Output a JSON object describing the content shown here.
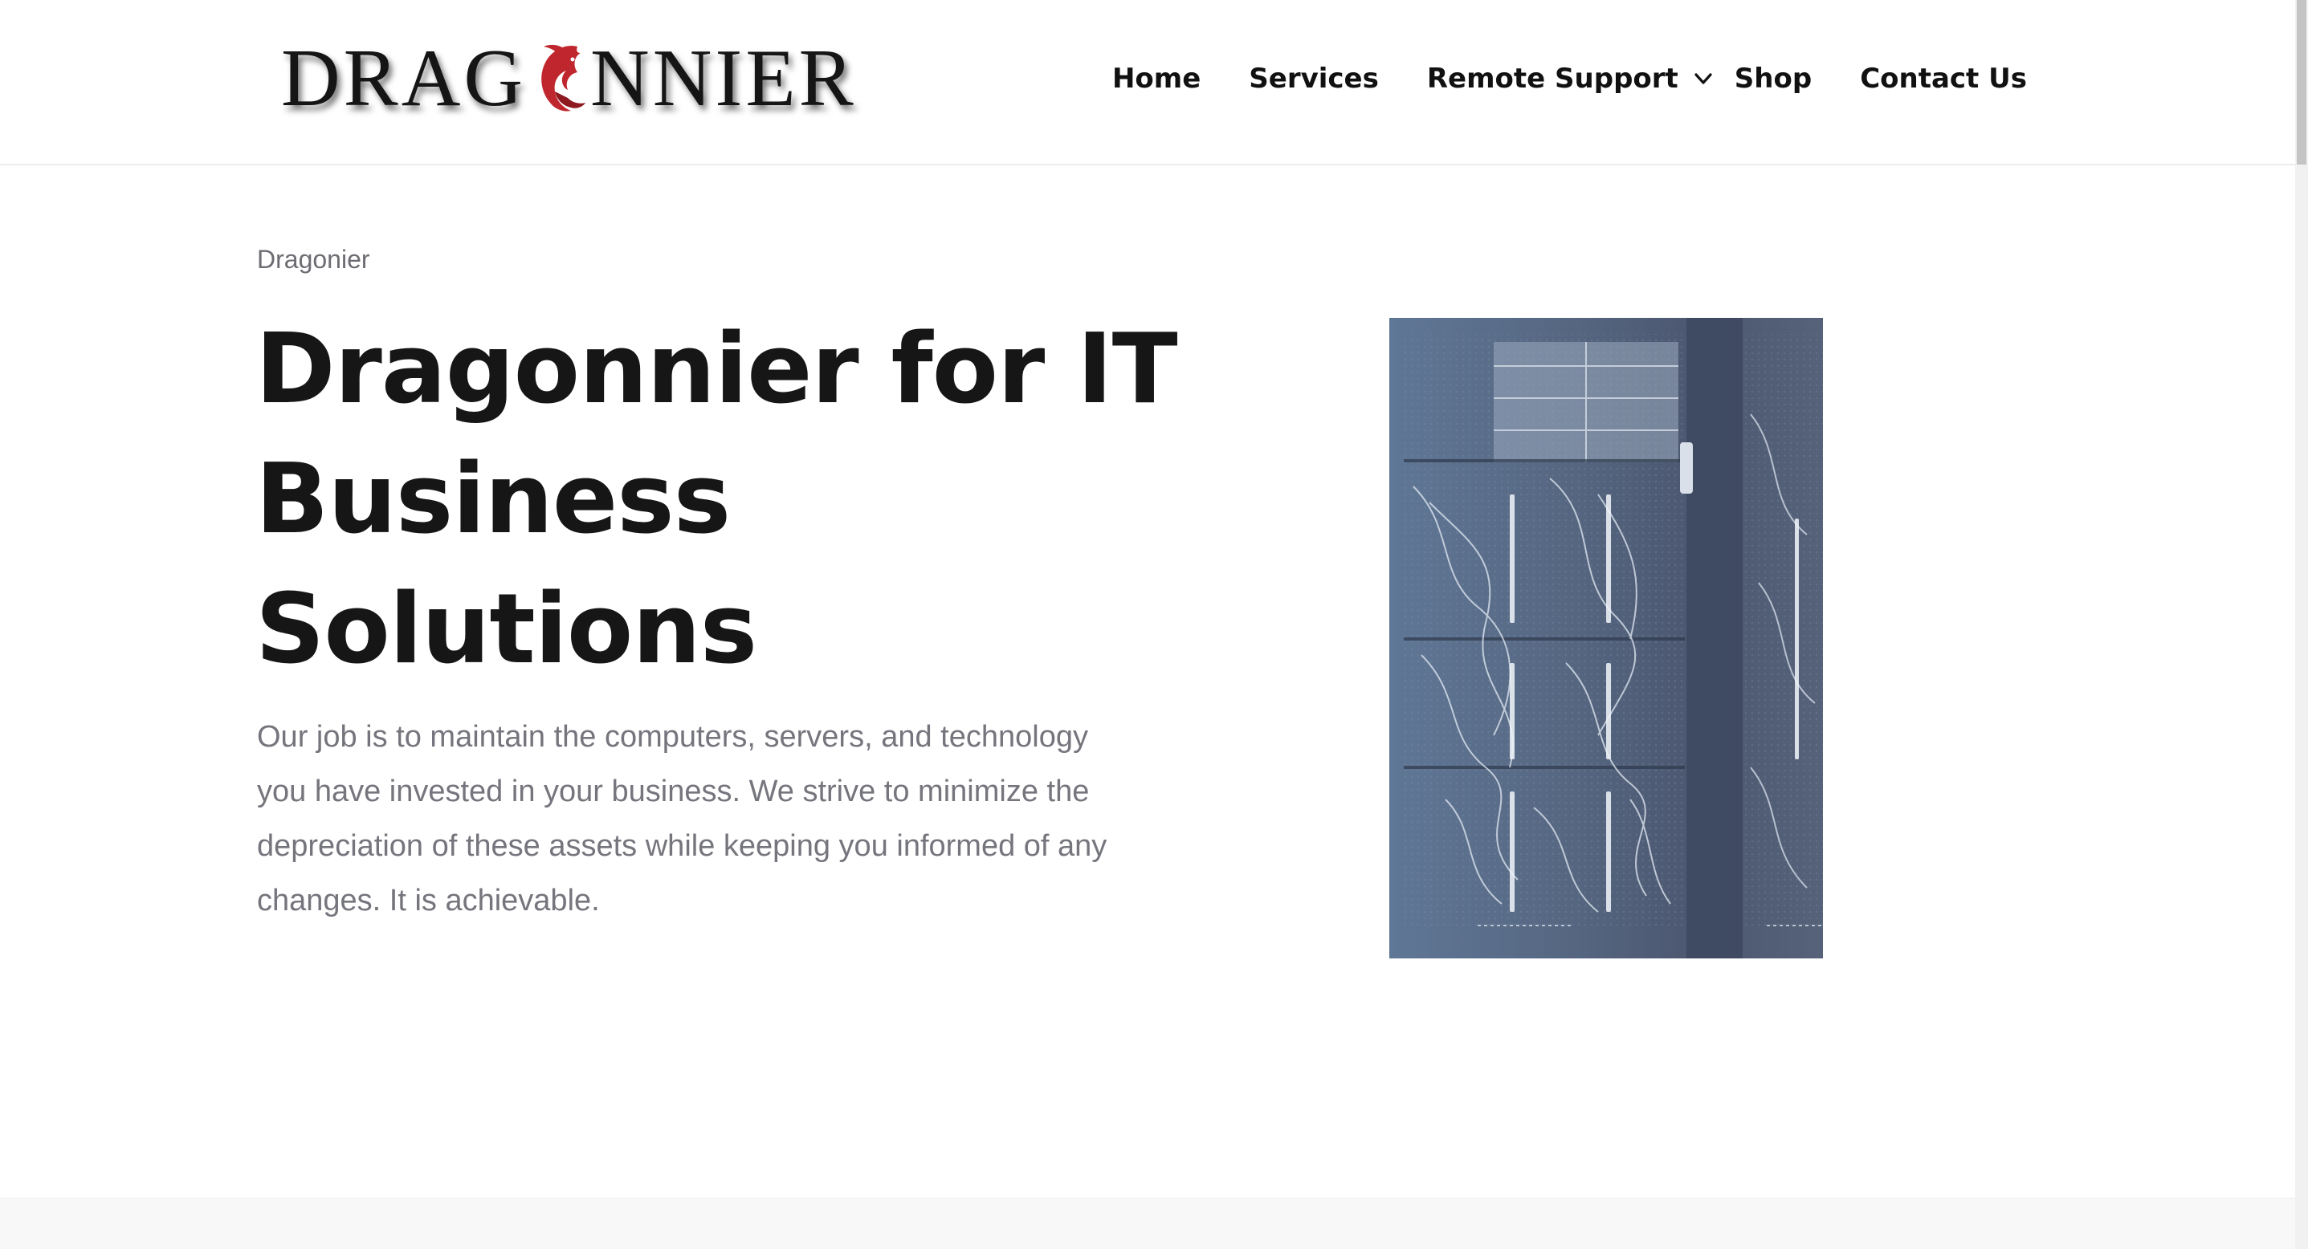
{
  "header": {
    "logo": {
      "text_left": "DRAG",
      "text_right": "NNIER",
      "dragon_color": "#c0262d"
    },
    "nav": [
      {
        "label": "Home"
      },
      {
        "label": "Services"
      },
      {
        "label": "Remote Support",
        "has_dropdown": true,
        "icon": "chevron-down-icon"
      },
      {
        "label": "Shop"
      },
      {
        "label": "Contact Us"
      }
    ]
  },
  "hero": {
    "eyebrow": "Dragonier",
    "headline": [
      "Dragonnier for IT",
      "Business",
      "Solutions"
    ],
    "body": "Our job is to maintain the computers, servers, and technology you have invested in your business. We strive to minimize the depreciation of these assets while keeping you informed of any changes. It is achievable.",
    "image": {
      "subject": "server-rack-image",
      "tint": "#5c7491"
    }
  },
  "colors": {
    "heading": "#161616",
    "body_text": "#75757d",
    "nav_text": "#111111",
    "header_border": "#ededed"
  }
}
